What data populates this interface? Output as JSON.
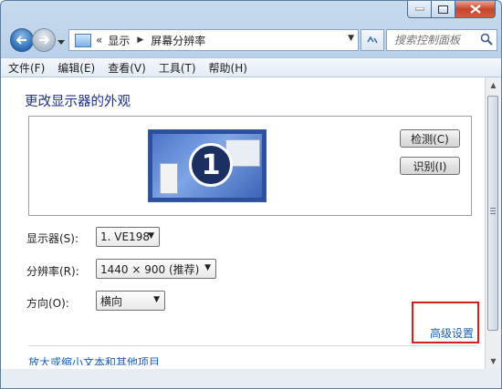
{
  "address": {
    "chevron": "«",
    "segments": [
      "显示",
      "屏幕分辨率"
    ]
  },
  "search": {
    "placeholder": "搜索控制面板"
  },
  "menu": [
    "文件(F)",
    "编辑(E)",
    "查看(V)",
    "工具(T)",
    "帮助(H)"
  ],
  "page": {
    "title": "更改显示器的外观",
    "monitor_number": "1",
    "detect_button": "检测(C)",
    "identify_button": "识别(I)"
  },
  "settings": {
    "display_label": "显示器(S):",
    "display_value": "1. VE198",
    "resolution_label": "分辨率(R):",
    "resolution_value": "1440 × 900 (推荐)",
    "orientation_label": "方向(O):",
    "orientation_value": "横向"
  },
  "links": {
    "advanced": "高级设置",
    "text_size": "放大或缩小文本和其他项目"
  },
  "colors": {
    "highlight_box": "#d41f1f",
    "link": "#1c5fb5",
    "title": "#1e3287"
  }
}
